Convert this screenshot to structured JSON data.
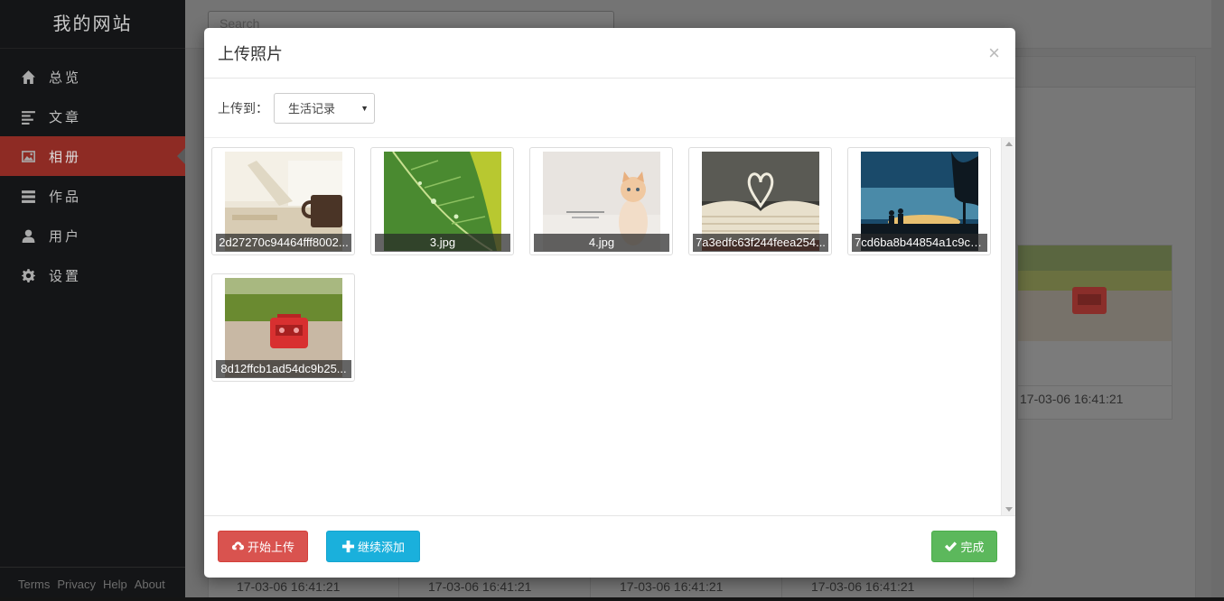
{
  "sidebar": {
    "brand": "我的网站",
    "items": [
      {
        "label": "总览",
        "icon": "home-icon",
        "active": false
      },
      {
        "label": "文章",
        "icon": "align-left-icon",
        "active": false
      },
      {
        "label": "相册",
        "icon": "picture-icon",
        "active": true
      },
      {
        "label": "作品",
        "icon": "tasks-icon",
        "active": false
      },
      {
        "label": "用户",
        "icon": "user-icon",
        "active": false
      },
      {
        "label": "设置",
        "icon": "cog-icon",
        "active": false
      }
    ],
    "footer_links": [
      "Terms",
      "Privacy",
      "Help",
      "About"
    ]
  },
  "page": {
    "search_placeholder": "Search",
    "card_date": "17-03-06 16:41:21",
    "bottom_dates": [
      "17-03-06 16:41:21",
      "17-03-06 16:41:21",
      "17-03-06 16:41:21",
      "17-03-06 16:41:21"
    ]
  },
  "modal": {
    "title": "上传照片",
    "close_glyph": "×",
    "upload_to_label": "上传到：",
    "album_selected": "生活记录",
    "files": [
      {
        "name": "2d27270c94464fff8002...",
        "icon": "photo-mug-icon"
      },
      {
        "name": "3.jpg",
        "icon": "photo-leaf-icon"
      },
      {
        "name": "4.jpg",
        "icon": "photo-kitten-icon"
      },
      {
        "name": "7a3edfc63f244feea254...",
        "icon": "photo-book-heart-icon"
      },
      {
        "name": "7cd6ba8b44854a1c9c3...",
        "icon": "photo-sunset-couple-icon"
      },
      {
        "name": "8d12ffcb1ad54dc9b25...",
        "icon": "photo-red-radio-icon"
      }
    ],
    "buttons": {
      "start_upload": "开始上传",
      "continue_add": "继续添加",
      "done": "完成"
    }
  },
  "colors": {
    "sidebar_bg": "#141517",
    "active_item": "#8e2b24",
    "btn_danger": "#d9534f",
    "btn_info": "#1ab0dc",
    "btn_success": "#5cb85c"
  }
}
